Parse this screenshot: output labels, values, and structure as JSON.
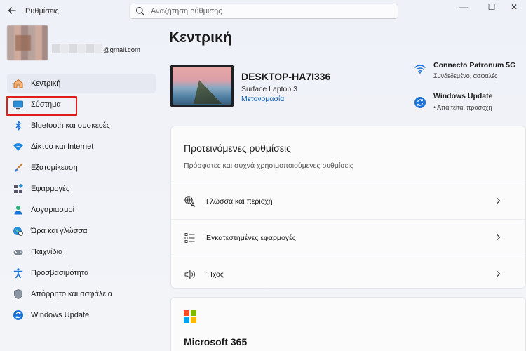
{
  "app": {
    "title": "Ρυθμίσεις",
    "back_icon": "arrow-left-icon",
    "search_placeholder": "Αναζήτηση ρύθμισης",
    "window_controls": {
      "minimize": "—",
      "maximize": "☐",
      "close": "✕"
    }
  },
  "profile": {
    "email_suffix": "@gmail.com"
  },
  "sidebar": {
    "items": [
      {
        "label": "Κεντρική",
        "icon": "home-icon",
        "active": true
      },
      {
        "label": "Σύστημα",
        "icon": "monitor-icon",
        "active": false
      },
      {
        "label": "Bluetooth και συσκευές",
        "icon": "bluetooth-icon",
        "active": false
      },
      {
        "label": "Δίκτυο και Internet",
        "icon": "wifi-icon",
        "active": false
      },
      {
        "label": "Εξατομίκευση",
        "icon": "brush-icon",
        "active": false
      },
      {
        "label": "Εφαρμογές",
        "icon": "apps-icon",
        "active": false
      },
      {
        "label": "Λογαριασμοί",
        "icon": "person-icon",
        "active": false
      },
      {
        "label": "Ώρα και γλώσσα",
        "icon": "globe-clock-icon",
        "active": false
      },
      {
        "label": "Παιχνίδια",
        "icon": "gamepad-icon",
        "active": false
      },
      {
        "label": "Προσβασιμότητα",
        "icon": "accessibility-icon",
        "active": false
      },
      {
        "label": "Απόρρητο και ασφάλεια",
        "icon": "shield-icon",
        "active": false
      },
      {
        "label": "Windows Update",
        "icon": "update-icon",
        "active": false
      }
    ]
  },
  "main": {
    "title": "Κεντρική",
    "device": {
      "name": "DESKTOP-HA7I336",
      "model": "Surface Laptop 3",
      "rename_link": "Μετονομασία"
    },
    "status": [
      {
        "title": "Connecto Patronum 5G",
        "subtitle": "Συνδεδεμένο, ασφαλές",
        "icon": "wifi-icon"
      },
      {
        "title": "Windows Update",
        "subtitle": "• Απαιτείται προσοχή",
        "icon": "update-icon"
      }
    ],
    "recommended": {
      "title": "Προτεινόμενες ρυθμίσεις",
      "subtitle": "Πρόσφατες και συχνά χρησιμοποιούμενες ρυθμίσεις",
      "rows": [
        {
          "label": "Γλώσσα και περιοχή",
          "icon": "language-icon"
        },
        {
          "label": "Εγκατεστημένες εφαρμογές",
          "icon": "list-icon"
        },
        {
          "label": "Ήχος",
          "icon": "speaker-icon"
        }
      ]
    },
    "m365": {
      "title": "Microsoft 365",
      "icon": "microsoft-logo-icon"
    }
  },
  "colors": {
    "accent": "#0e5fb5",
    "highlight": "#e01b1b",
    "ms_red": "#f25022",
    "ms_green": "#7fba00",
    "ms_blue": "#00a4ef",
    "ms_yellow": "#ffb900"
  }
}
